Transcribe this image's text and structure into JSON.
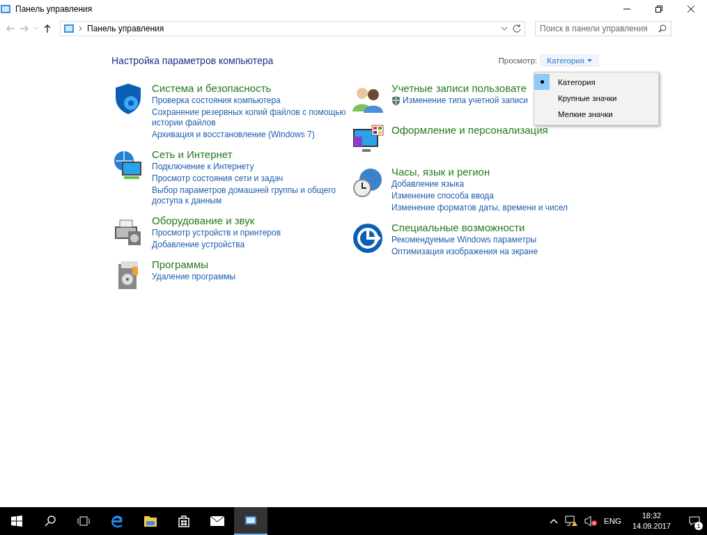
{
  "window": {
    "title": "Панель управления"
  },
  "address_bar": {
    "path": "Панель управления",
    "search_placeholder": "Поиск в панели управления"
  },
  "heading": "Настройка параметров компьютера",
  "view": {
    "label": "Просмотр:",
    "value": "Категория",
    "menu": [
      {
        "label": "Категория",
        "selected": true
      },
      {
        "label": "Крупные значки",
        "selected": false
      },
      {
        "label": "Мелкие значки",
        "selected": false
      }
    ]
  },
  "columns": [
    [
      {
        "kind": "security",
        "title": "Система и безопасность",
        "links": [
          {
            "text": "Проверка состояния компьютера",
            "shield": false
          },
          {
            "text": "Сохранение резервных копий файлов с помощью истории файлов",
            "shield": false
          },
          {
            "text": "Архивация и восстановление (Windows 7)",
            "shield": false
          }
        ]
      },
      {
        "kind": "network",
        "title": "Сеть и Интернет",
        "links": [
          {
            "text": "Подключение к Интернету",
            "shield": false
          },
          {
            "text": "Просмотр состояния сети и задач",
            "shield": false
          },
          {
            "text": "Выбор параметров домашней группы и общего доступа к данным",
            "shield": false
          }
        ]
      },
      {
        "kind": "hardware",
        "title": "Оборудование и звук",
        "links": [
          {
            "text": "Просмотр устройств и принтеров",
            "shield": false
          },
          {
            "text": "Добавление устройства",
            "shield": false
          }
        ]
      },
      {
        "kind": "programs",
        "title": "Программы",
        "links": [
          {
            "text": "Удаление программы",
            "shield": false
          }
        ]
      }
    ],
    [
      {
        "kind": "users",
        "title": "Учетные записи пользовате",
        "links": [
          {
            "text": "Изменение типа учетной записи",
            "shield": true
          }
        ]
      },
      {
        "kind": "appearance",
        "title": "Оформление и персонализация"
      },
      {
        "kind": "clock",
        "title": "Часы, язык и регион",
        "links": [
          {
            "text": "Добавление языка",
            "shield": false
          },
          {
            "text": "Изменение способа ввода",
            "shield": false
          },
          {
            "text": "Изменение форматов даты, времени и чисел",
            "shield": false
          }
        ]
      },
      {
        "kind": "access",
        "title": "Специальные возможности",
        "links": [
          {
            "text": "Рекомендуемые Windows параметры",
            "shield": false
          },
          {
            "text": "Оптимизация изображения на экране",
            "shield": false
          }
        ]
      }
    ]
  ],
  "taskbar": {
    "language": "ENG",
    "time": "18:32",
    "date": "14.09.2017",
    "notifications": "1"
  }
}
